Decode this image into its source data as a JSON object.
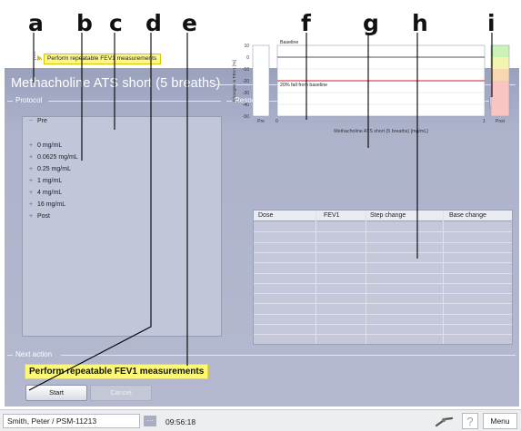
{
  "callouts": [
    "a",
    "b",
    "c",
    "d",
    "e",
    "f",
    "g",
    "h",
    "i"
  ],
  "window": {
    "title": "Methacholine ATS short (5 breaths)"
  },
  "protocol": {
    "group_title": "Protocol",
    "items": [
      {
        "label": "Pre",
        "expander": "−"
      },
      {
        "label": "0 mg/mL",
        "expander": "+"
      },
      {
        "label": "0.0625 mg/mL",
        "expander": "+"
      },
      {
        "label": "0.25 mg/mL",
        "expander": "+"
      },
      {
        "label": "1 mg/mL",
        "expander": "+"
      },
      {
        "label": "4 mg/mL",
        "expander": "+"
      },
      {
        "label": "16 mg/mL",
        "expander": "+"
      },
      {
        "label": "Post",
        "expander": "+"
      }
    ],
    "child_label": "Perform repeatable FEV1 measurements"
  },
  "response": {
    "group_title": "Response",
    "zoom_icon": "zoom-icon"
  },
  "chart_data": {
    "type": "line",
    "ylabel": "Changes in FEV1 [%]",
    "xlabel": "Methacholine ATS short (5 breaths) [mg/mL]",
    "ylim": [
      -50,
      10
    ],
    "yticks": [
      "10",
      "0",
      "-10",
      "-20",
      "-30",
      "-40",
      "-50"
    ],
    "x_start_label": "0",
    "x_end_label": "1",
    "pre_label": "Pre",
    "post_label": "Post",
    "series": [
      {
        "name": "Baseline",
        "values": [
          0,
          0
        ],
        "color": "#222222"
      },
      {
        "name": "20% fall from baseline",
        "values": [
          -20,
          -20
        ],
        "color": "#d62020"
      }
    ],
    "severity_bands": [
      {
        "to": 10,
        "from": 0,
        "color": "#cdf2b8"
      },
      {
        "to": 0,
        "from": -10,
        "color": "#f2f5b0"
      },
      {
        "to": -10,
        "from": -20,
        "color": "#f8d6b0"
      },
      {
        "to": -20,
        "from": -50,
        "color": "#f8c4c4"
      }
    ]
  },
  "table": {
    "headers": [
      "Dose",
      "FEV1",
      "Step change",
      "Base change"
    ],
    "rows": []
  },
  "next_action": {
    "group_title": "Next action",
    "text": "Perform repeatable FEV1 measurements"
  },
  "buttons": {
    "start": "Start",
    "cancel": "Cancel"
  },
  "status": {
    "patient": "Smith, Peter / PSM-11213",
    "more": "···",
    "time": "09:56:18",
    "help": "?",
    "menu": "Menu"
  }
}
